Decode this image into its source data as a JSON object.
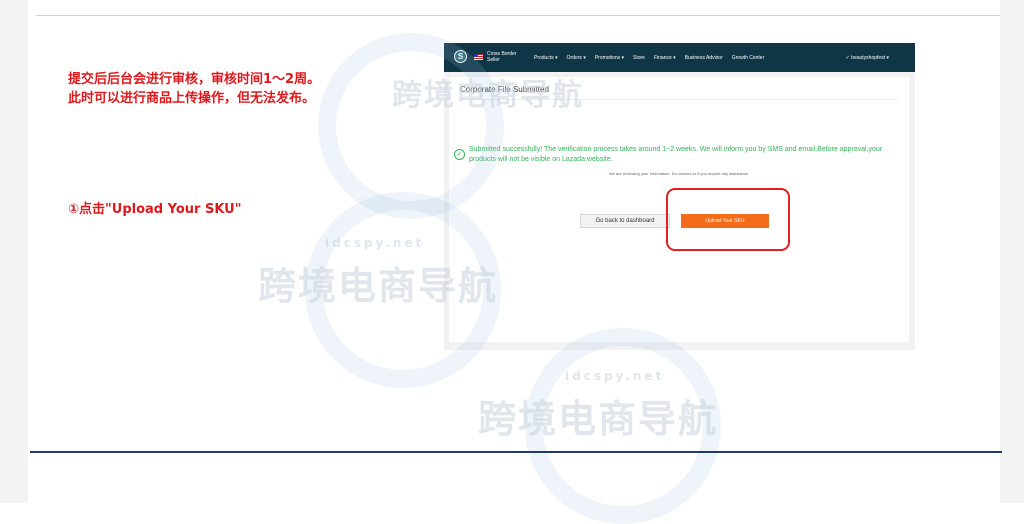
{
  "slide": {
    "note_lines": [
      "提交后后台会进行审核，审核时间1～2周。",
      "此时可以进行商品上传操作，但无法发布。"
    ],
    "step_label": "①点击\"Upload Your SKU\""
  },
  "seller_center": {
    "nav": {
      "logo_letter": "S",
      "region_line1": "Cross Border",
      "region_line2": "Seller",
      "menu": [
        "Products ▾",
        "Orders ▾",
        "Promotions ▾",
        "Store",
        "Finance ▾",
        "Business Advisor",
        "Growth Center"
      ],
      "user": "✓ beautyshopfest ▾"
    },
    "page_title": "Corporate File Submitted",
    "success_message": "Submitted successfully! The verification process takes around 1~2 weeks. We will inform you by SMS and email.Before approval,your products will not be visible on Lazada website.",
    "review_note": "We are reviewing your information. Do contact us if you require any assistance.",
    "back_button": "Go back to dashboard",
    "upload_button": "Upload Your SKU"
  },
  "watermark": {
    "text": "跨境电商导航",
    "domain": "idcspy.net"
  },
  "colors": {
    "annotation_red": "#e0181c",
    "nav_bg": "#0f3646",
    "success_green": "#35b25a",
    "upload_orange": "#f26c19"
  }
}
